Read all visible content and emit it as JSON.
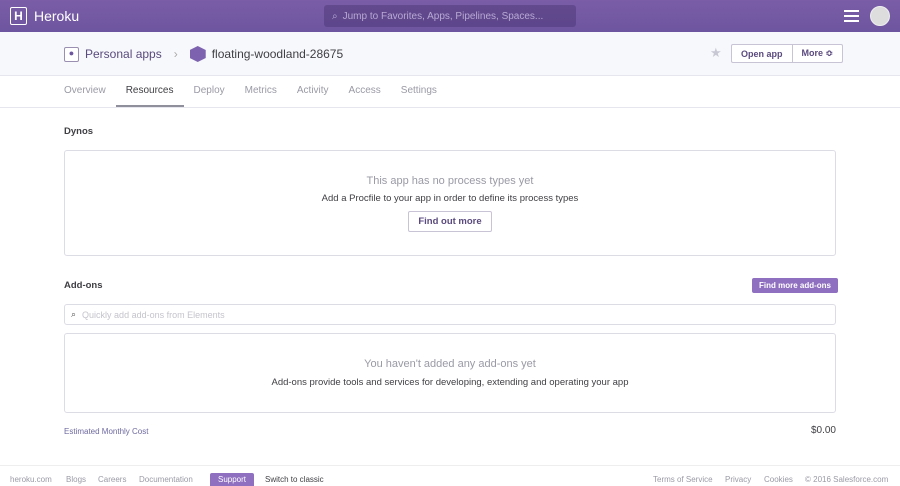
{
  "header": {
    "brand": "Heroku",
    "logo_letter": "H",
    "search_placeholder": "Jump to Favorites, Apps, Pipelines, Spaces..."
  },
  "breadcrumb": {
    "parent": "Personal apps",
    "app": "floating-woodland-28675"
  },
  "actions": {
    "open_app": "Open app",
    "more": "More ≎"
  },
  "tabs": [
    "Overview",
    "Resources",
    "Deploy",
    "Metrics",
    "Activity",
    "Access",
    "Settings"
  ],
  "dynos": {
    "title": "Dynos",
    "empty_title": "This app has no process types yet",
    "empty_text": "Add a Procfile to your app in order to define its process types",
    "button": "Find out more"
  },
  "addons": {
    "title": "Add-ons",
    "find_button": "Find more add-ons",
    "search_placeholder": "Quickly add add-ons from Elements",
    "empty_title": "You haven't added any add-ons yet",
    "empty_text": "Add-ons provide tools and services for developing, extending and operating your app"
  },
  "cost": {
    "label": "Estimated Monthly Cost",
    "value": "$0.00"
  },
  "footer": {
    "links": [
      "heroku.com",
      "Blogs",
      "Careers",
      "Documentation",
      "Support",
      "Switch to classic"
    ],
    "right": [
      "Terms of Service",
      "Privacy",
      "Cookies",
      "© 2016 Salesforce.com"
    ]
  }
}
